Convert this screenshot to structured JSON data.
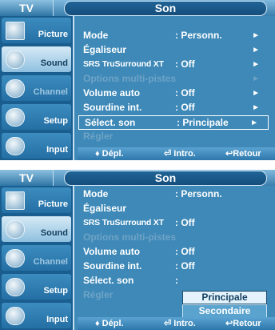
{
  "screens": [
    {
      "source_tab": "TV",
      "title": "Son",
      "sidebar": [
        {
          "label": "Picture",
          "state": "normal"
        },
        {
          "label": "Sound",
          "state": "active"
        },
        {
          "label": "Channel",
          "state": "dim"
        },
        {
          "label": "Setup",
          "state": "normal"
        },
        {
          "label": "Input",
          "state": "normal"
        }
      ],
      "menu": [
        {
          "label": "Mode",
          "value": ": Personn.",
          "arrow": "►",
          "state": "normal"
        },
        {
          "label": "Égaliseur",
          "value": "",
          "arrow": "►",
          "state": "normal"
        },
        {
          "label": "SRS TruSurround XT",
          "value": ": Off",
          "arrow": "►",
          "state": "normal"
        },
        {
          "label": "Options multi-pistes",
          "value": "",
          "arrow": "►",
          "state": "disabled"
        },
        {
          "label": "Volume auto",
          "value": ": Off",
          "arrow": "►",
          "state": "normal"
        },
        {
          "label": "Sourdine int.",
          "value": ": Off",
          "arrow": "►",
          "state": "normal"
        },
        {
          "label": "Sélect. son",
          "value": ": Principale",
          "arrow": "►",
          "state": "highlight"
        },
        {
          "label": "Régler",
          "value": "",
          "arrow": "",
          "state": "disabled"
        }
      ],
      "footer": {
        "move": "♦ Dépl.",
        "enter": "⏎ Intro.",
        "return": "↩Retour"
      }
    },
    {
      "source_tab": "TV",
      "title": "Son",
      "sidebar": [
        {
          "label": "Picture",
          "state": "normal"
        },
        {
          "label": "Sound",
          "state": "active"
        },
        {
          "label": "Channel",
          "state": "dim"
        },
        {
          "label": "Setup",
          "state": "normal"
        },
        {
          "label": "Input",
          "state": "normal"
        }
      ],
      "menu": [
        {
          "label": "Mode",
          "value": ": Personn.",
          "arrow": "",
          "state": "normal"
        },
        {
          "label": "Égaliseur",
          "value": "",
          "arrow": "",
          "state": "normal"
        },
        {
          "label": "SRS TruSurround XT",
          "value": ": Off",
          "arrow": "",
          "state": "normal"
        },
        {
          "label": "Options multi-pistes",
          "value": "",
          "arrow": "",
          "state": "disabled"
        },
        {
          "label": "Volume auto",
          "value": ": Off",
          "arrow": "",
          "state": "normal"
        },
        {
          "label": "Sourdine int.",
          "value": ": Off",
          "arrow": "",
          "state": "normal"
        },
        {
          "label": "Sélect. son",
          "value": ":",
          "arrow": "",
          "state": "normal"
        },
        {
          "label": "Régler",
          "value": "",
          "arrow": "",
          "state": "disabled"
        }
      ],
      "dropdown": {
        "selected": "Principale",
        "other": "Secondaire"
      },
      "footer": {
        "move": "♦ Dépl.",
        "enter": "⏎ Intro.",
        "return": "↩Retour"
      }
    }
  ]
}
